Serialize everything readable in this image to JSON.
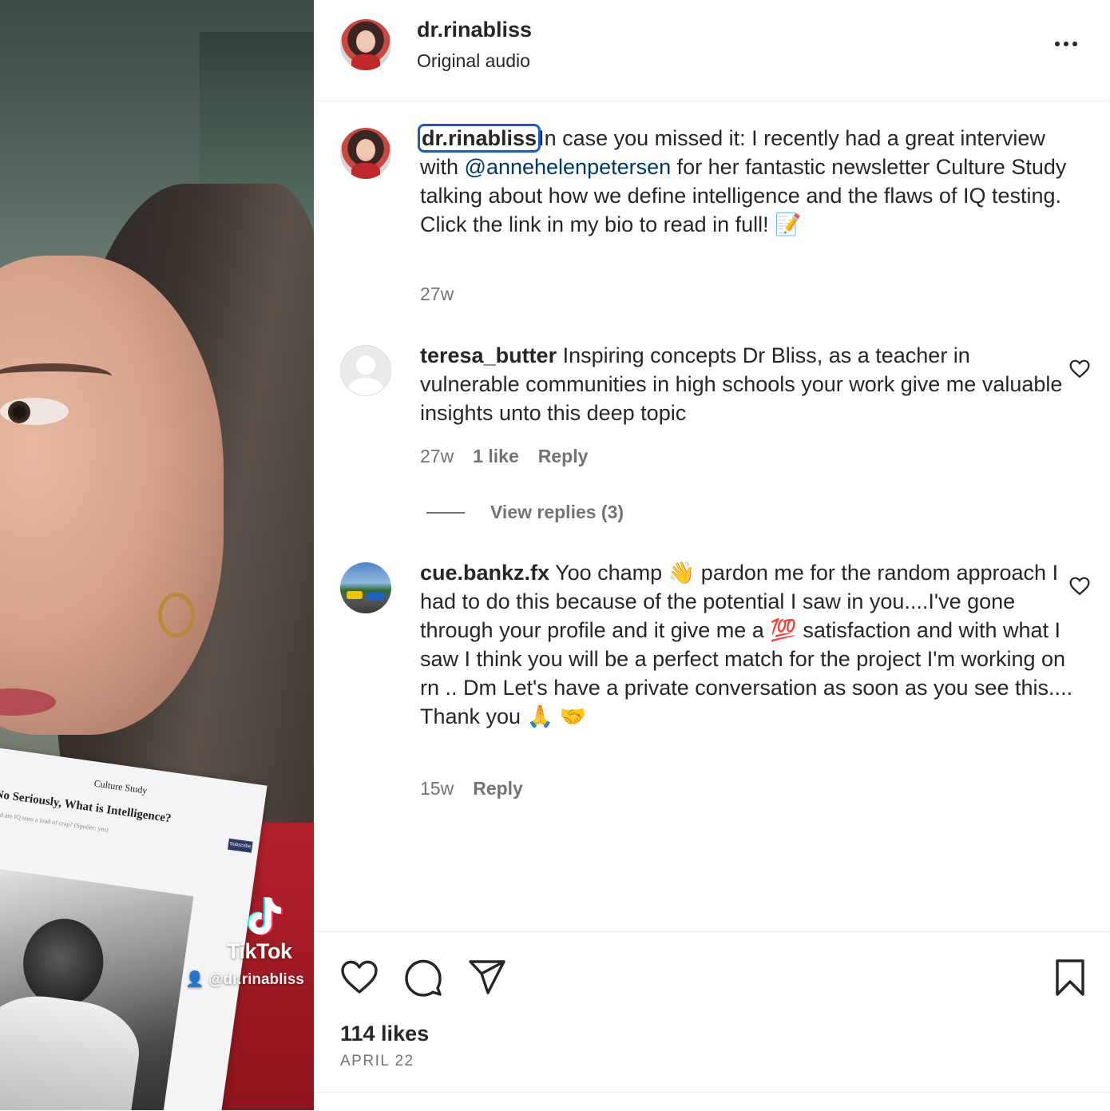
{
  "media": {
    "card_brand": "Culture Study",
    "card_headline": "No Seriously, What is Intelligence?",
    "card_sub": "And are IQ tests a load of crap? (Spoiler: yes)",
    "card_subscribe": "Subscribe",
    "tiktok_brand": "TikTok",
    "tiktok_user": "@dr.rinabliss"
  },
  "header": {
    "username": "dr.rinabliss",
    "audio": "Original audio"
  },
  "caption": {
    "username": "dr.rinabliss",
    "text_before": "In case you missed it: I recently had a great interview with ",
    "mention": "@annehelenpetersen",
    "text_after": " for her fantastic newsletter Culture Study talking about how we define intelligence and the flaws of IQ testing. Click the link in my bio to read in full! 📝",
    "age": "27w"
  },
  "comments": [
    {
      "username": "teresa_butter",
      "text": "Inspiring concepts Dr Bliss, as a teacher in vulnerable communities in high schools your work give me valuable insights unto this deep topic",
      "age": "27w",
      "likes": "1 like",
      "reply": "Reply",
      "view_replies": "View replies (3)"
    },
    {
      "username": "cue.bankz.fx",
      "text": "Yoo champ 👋 pardon me for the random approach I had to do this because of the potential I saw in you....I've gone through your profile and it give me a 💯 satisfaction and with what I saw I think you will be a perfect match for the project I'm working on rn .. Dm Let's have a private conversation as soon as you see this.... Thank you 🙏 🤝",
      "age": "15w",
      "reply": "Reply"
    }
  ],
  "footer": {
    "likes": "114 likes",
    "date": "APRIL 22"
  },
  "icons": {
    "like": "heart-icon",
    "comment": "comment-icon",
    "share": "paper-plane-icon",
    "save": "bookmark-icon",
    "more": "more-horizontal-icon"
  }
}
